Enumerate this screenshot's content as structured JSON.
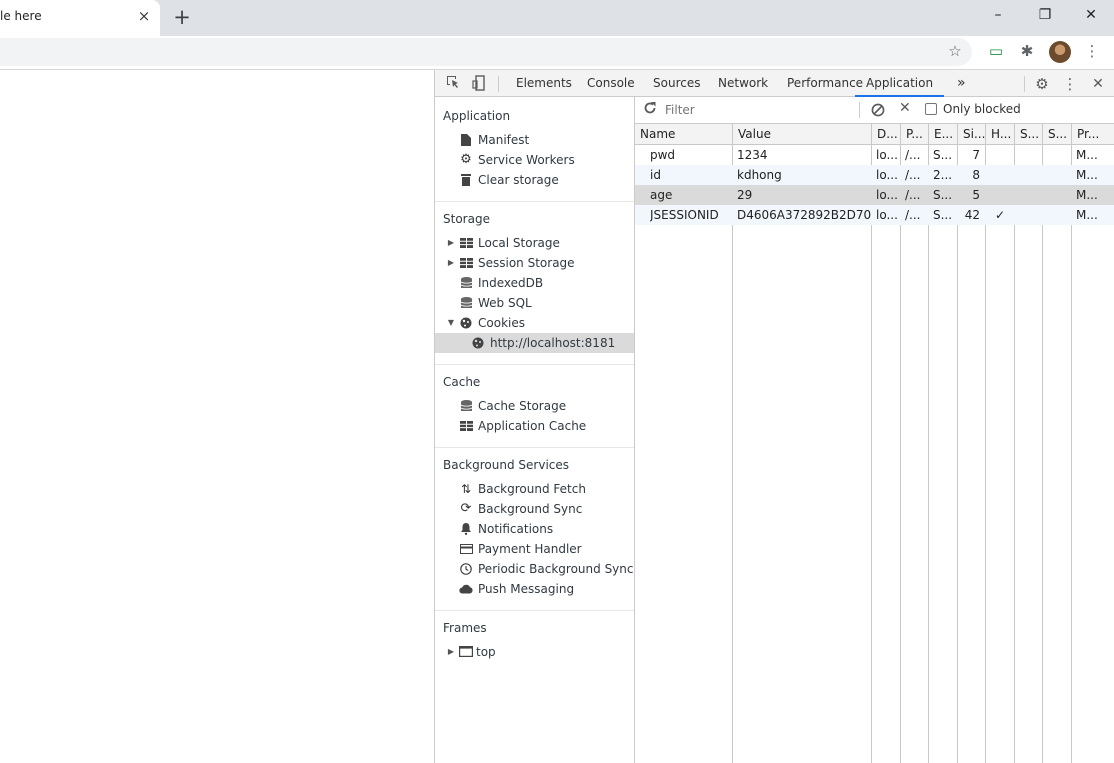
{
  "browser": {
    "tab_title": "le here",
    "tab_close": "×",
    "new_tab": "+",
    "win_min": "–",
    "win_restore": "❐",
    "win_close": "✕"
  },
  "toolbar": {
    "star_icon": "☆",
    "ext1_icon": "▭",
    "puzzle_icon": "✱",
    "menu_icon": "⋮"
  },
  "devtools": {
    "tabs": [
      {
        "label": "Elements"
      },
      {
        "label": "Console"
      },
      {
        "label": "Sources"
      },
      {
        "label": "Network"
      },
      {
        "label": "Performance"
      },
      {
        "label": "Application"
      }
    ],
    "more": "»",
    "settings_icon": "⚙",
    "kebab_icon": "⋮",
    "close_icon": "✕"
  },
  "sidebar": {
    "application": {
      "title": "Application",
      "items": [
        "Manifest",
        "Service Workers",
        "Clear storage"
      ]
    },
    "storage": {
      "title": "Storage",
      "items": [
        "Local Storage",
        "Session Storage",
        "IndexedDB",
        "Web SQL",
        "Cookies",
        "http://localhost:8181"
      ]
    },
    "cache": {
      "title": "Cache",
      "items": [
        "Cache Storage",
        "Application Cache"
      ]
    },
    "background": {
      "title": "Background Services",
      "items": [
        "Background Fetch",
        "Background Sync",
        "Notifications",
        "Payment Handler",
        "Periodic Background Sync",
        "Push Messaging"
      ]
    },
    "frames": {
      "title": "Frames",
      "items": [
        "top"
      ]
    }
  },
  "cookies": {
    "filter_placeholder": "Filter",
    "only_blocked": "Only blocked",
    "headers": [
      "Name",
      "Value",
      "D...",
      "P...",
      "E...",
      "Si...",
      "H...",
      "S...",
      "S...",
      "Pr..."
    ],
    "rows": [
      [
        "pwd",
        "1234",
        "lo...",
        "/...",
        "S...",
        "7",
        "",
        "",
        "",
        "M..."
      ],
      [
        "id",
        "kdhong",
        "lo...",
        "/...",
        "2...",
        "8",
        "",
        "",
        "",
        "M..."
      ],
      [
        "age",
        "29",
        "lo...",
        "/...",
        "S...",
        "5",
        "",
        "",
        "",
        "M..."
      ],
      [
        "JSESSIONID",
        "D4606A372892B2D70...",
        "lo...",
        "/...",
        "S...",
        "42",
        "✓",
        "",
        "",
        "M..."
      ]
    ],
    "selected_row": 2
  }
}
